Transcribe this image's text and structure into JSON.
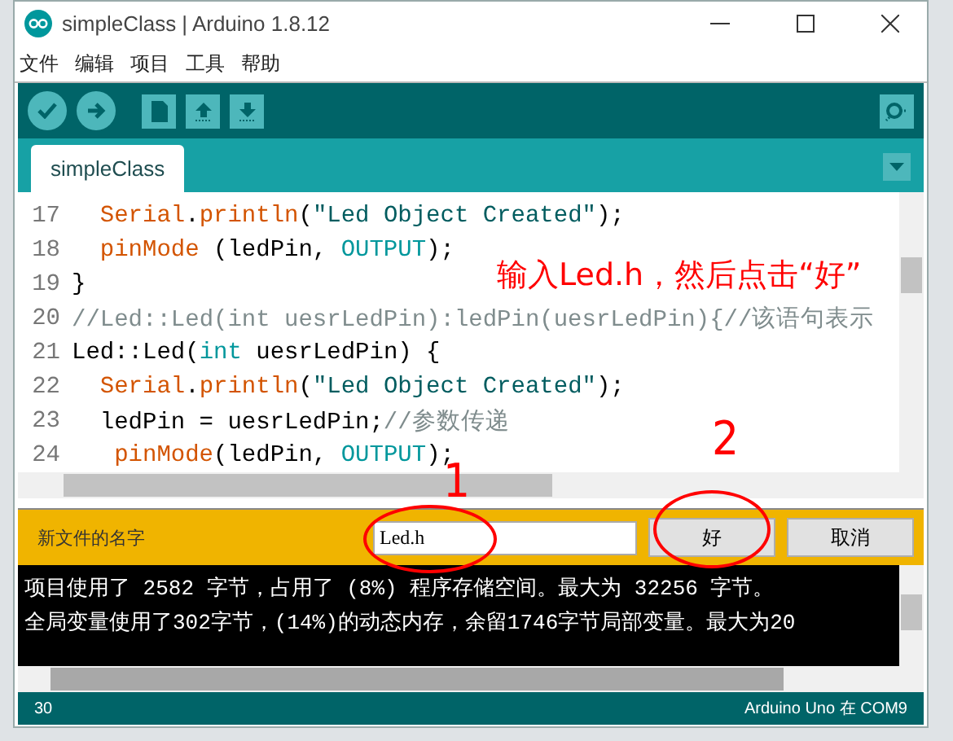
{
  "window": {
    "title": "simpleClass | Arduino 1.8.12"
  },
  "menu": [
    "文件",
    "编辑",
    "项目",
    "工具",
    "帮助"
  ],
  "tabs": [
    {
      "label": "simpleClass",
      "selected": true
    }
  ],
  "code_lines": [
    {
      "number": "17",
      "kind": "body",
      "tokens": [
        {
          "kind": "func",
          "text": "Serial"
        },
        {
          "kind": "plain",
          "text": "."
        },
        {
          "kind": "func",
          "text": "println"
        },
        {
          "kind": "plain",
          "text": "("
        },
        {
          "kind": "string",
          "text": "\"Led Object Created\""
        },
        {
          "kind": "plain",
          "text": ");"
        }
      ]
    },
    {
      "number": "18",
      "kind": "body",
      "tokens": [
        {
          "kind": "func",
          "text": "pinMode"
        },
        {
          "kind": "plain",
          "text": " (ledPin, "
        },
        {
          "kind": "const",
          "text": "OUTPUT"
        },
        {
          "kind": "plain",
          "text": ");"
        }
      ]
    },
    {
      "number": "19",
      "kind": "top",
      "tokens": [
        {
          "kind": "plain",
          "text": "}"
        }
      ]
    },
    {
      "number": "20",
      "kind": "top",
      "tokens": [
        {
          "kind": "comment",
          "text": "//Led::Led(int uesrLedPin):ledPin(uesrLedPin){//该语句表示"
        }
      ]
    },
    {
      "number": "21",
      "kind": "top",
      "tokens": [
        {
          "kind": "plain",
          "text": "Led::Led("
        },
        {
          "kind": "const",
          "text": "int"
        },
        {
          "kind": "plain",
          "text": " uesrLedPin) {"
        }
      ]
    },
    {
      "number": "22",
      "kind": "body",
      "tokens": [
        {
          "kind": "func",
          "text": "Serial"
        },
        {
          "kind": "plain",
          "text": "."
        },
        {
          "kind": "func",
          "text": "println"
        },
        {
          "kind": "plain",
          "text": "("
        },
        {
          "kind": "string",
          "text": "\"Led Object Created\""
        },
        {
          "kind": "plain",
          "text": ");"
        }
      ]
    },
    {
      "number": "23",
      "kind": "body",
      "tokens": [
        {
          "kind": "plain",
          "text": "ledPin = uesrLedPin;"
        },
        {
          "kind": "comment",
          "text": "//参数传递"
        }
      ]
    },
    {
      "number": "24",
      "kind": "continued",
      "tokens": [
        {
          "kind": "func",
          "text": "pinMode"
        },
        {
          "kind": "plain",
          "text": "(ledPin, "
        },
        {
          "kind": "const",
          "text": "OUTPUT"
        },
        {
          "kind": "plain",
          "text": ");"
        }
      ]
    }
  ],
  "prompt": {
    "label": "新文件的名字",
    "value": "Led.h",
    "buttons": [
      "好",
      "取消"
    ]
  },
  "console_lines": [
    "项目使用了 2582 字节，占用了 (8%) 程序存储空间。最大为 32256 字节。",
    "全局变量使用了302字节，(14%)的动态内存，余留1746字节局部变量。最大为20"
  ],
  "status_bar": {
    "line": "30",
    "board": "Arduino Uno 在 COM9"
  },
  "annotations": [
    {
      "kind": "note",
      "text": "输入Led.h，然后点击“好”"
    },
    {
      "kind": "step",
      "text": "1"
    },
    {
      "kind": "step",
      "text": "2"
    }
  ]
}
